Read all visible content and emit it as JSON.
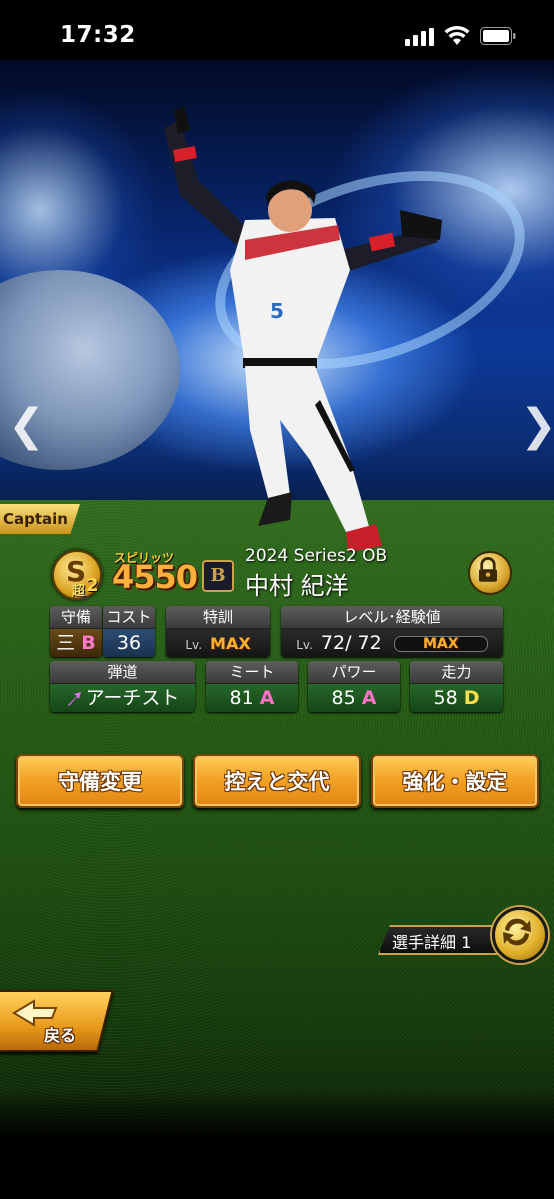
{
  "status_bar": {
    "time": "17:32"
  },
  "card": {
    "captain_label": "Captain",
    "rank_letter": "S",
    "rank_kanji": "超",
    "rank_level": "2",
    "spirits_label": "スピリッツ",
    "spirits_value": "4550",
    "team_logo": "B",
    "series": "2024 Series2 OB",
    "player_name": "中村 紀洋"
  },
  "stats": {
    "defense": {
      "label": "守備",
      "position": "三",
      "grade": "B"
    },
    "cost": {
      "label": "コスト",
      "value": "36"
    },
    "special_training": {
      "label": "特訓",
      "lv_prefix": "Lv.",
      "value": "MAX"
    },
    "level_exp": {
      "label": "レベル･経験値",
      "lv_prefix": "Lv.",
      "value": "72/ 72",
      "exp": "MAX"
    },
    "trajectory": {
      "label": "弾道",
      "value": "アーチスト"
    },
    "meet": {
      "label": "ミート",
      "value": "81",
      "grade": "A"
    },
    "power": {
      "label": "パワー",
      "value": "85",
      "grade": "A"
    },
    "speed": {
      "label": "走力",
      "value": "58",
      "grade": "D"
    }
  },
  "actions": {
    "change_defense": "守備変更",
    "swap_bench": "控えと交代",
    "enhance_settings": "強化・設定"
  },
  "detail_switch": {
    "label": "選手詳細 1"
  },
  "back_button": {
    "label": "戻る"
  },
  "colors": {
    "button_orange": "#f3a326",
    "grade_pink": "#ff6fc6",
    "grade_yellow": "#ffe04a",
    "gold": "#c9a24a"
  }
}
